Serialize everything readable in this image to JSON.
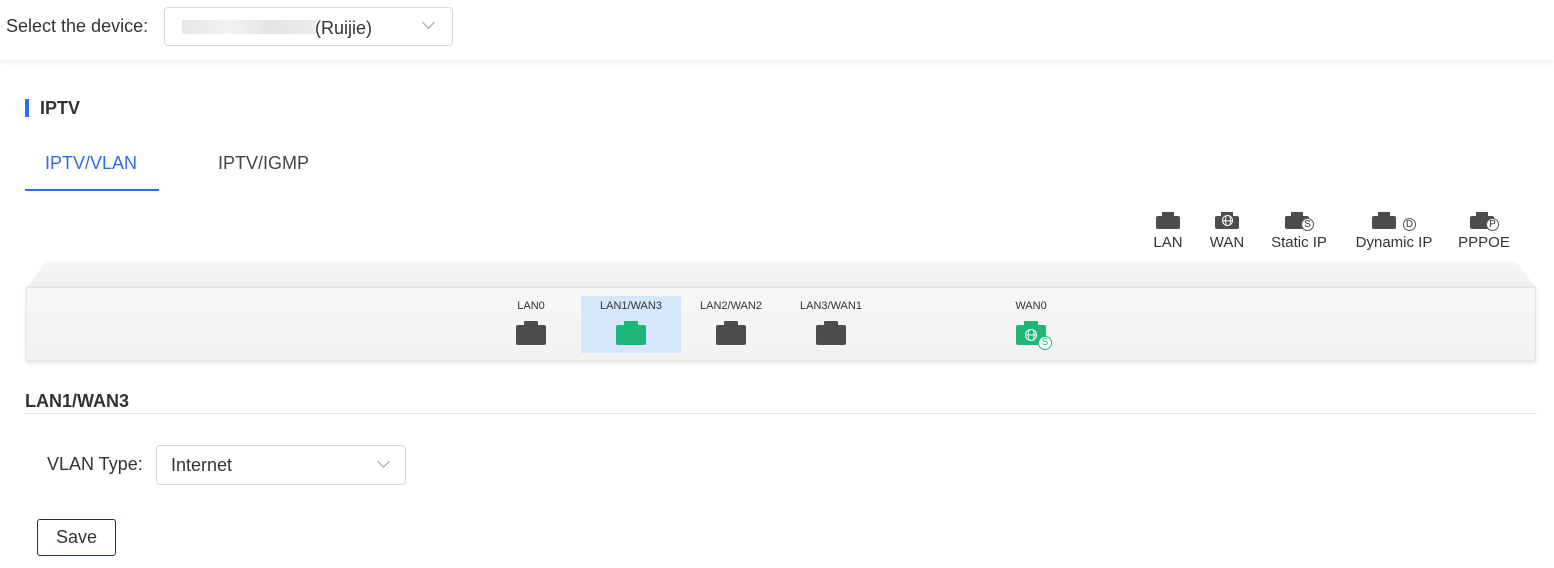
{
  "device": {
    "label": "Select the device:",
    "value": "(Ruijie)"
  },
  "section": {
    "title": "IPTV"
  },
  "tabs": [
    {
      "label": "IPTV/VLAN",
      "active": true
    },
    {
      "label": "IPTV/IGMP",
      "active": false
    }
  ],
  "legend": [
    {
      "label": "LAN",
      "icon": "lan-port-icon"
    },
    {
      "label": "WAN",
      "icon": "wan-globe-port-icon"
    },
    {
      "label": "Static IP",
      "icon": "static-ip-port-icon",
      "badge": "S"
    },
    {
      "label": "Dynamic IP",
      "icon": "dynamic-ip-port-icon",
      "badge": "D"
    },
    {
      "label": "PPPOE",
      "icon": "pppoe-port-icon",
      "badge": "P"
    }
  ],
  "ports": [
    {
      "label": "LAN0",
      "state": "inactive"
    },
    {
      "label": "LAN1/WAN3",
      "state": "active",
      "selected": true
    },
    {
      "label": "LAN2/WAN2",
      "state": "inactive"
    },
    {
      "label": "LAN3/WAN1",
      "state": "inactive"
    },
    {
      "label": "WAN0",
      "state": "active",
      "badge": "S"
    }
  ],
  "detail": {
    "title": "LAN1/WAN3"
  },
  "vlan": {
    "label": "VLAN Type:",
    "value": "Internet"
  },
  "actions": {
    "save_label": "Save"
  },
  "colors": {
    "accent": "#2f6bea",
    "active_port": "#1fb779",
    "inactive_port": "#4d4d4d",
    "selected_bg": "#d6e7fb",
    "button_border": "#1e2a6e"
  }
}
